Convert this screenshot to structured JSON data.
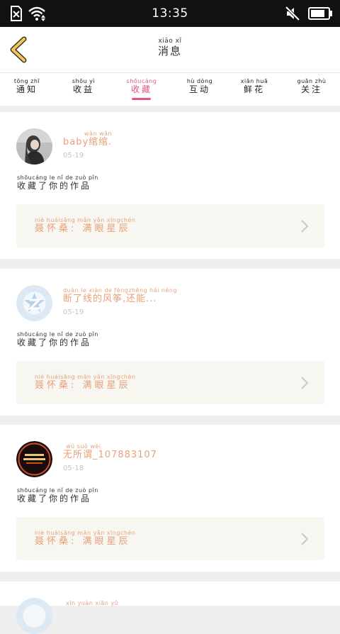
{
  "status_bar": {
    "time": "13:35"
  },
  "header": {
    "title_pinyin": "xiāo  xī",
    "title": "消息"
  },
  "tabs": [
    {
      "pinyin": "tōng zhī",
      "label": "通知"
    },
    {
      "pinyin": "shōu yì",
      "label": "收益"
    },
    {
      "pinyin": "shōucáng",
      "label": "收藏"
    },
    {
      "pinyin": "hù dòng",
      "label": "互动"
    },
    {
      "pinyin": "xiān huā",
      "label": "鲜花"
    },
    {
      "pinyin": "guān zhù",
      "label": "关注"
    }
  ],
  "active_tab_index": 2,
  "colors": {
    "accent": "#e2577f",
    "name": "#e9a07a",
    "work_bg": "#f7f6f0"
  },
  "cards": [
    {
      "avatar": "photo-avatar",
      "name_pinyin": "wǎn wǎn",
      "name": "baby绾绾.",
      "date": "05-19",
      "action_pinyin": "shōucáng le  nǐ  de zuò pǐn",
      "action": "收藏了你的作品",
      "work_pinyin": "niè huáisāng   mǎn yǎn xīngchén",
      "work": "聂怀桑: 满眼星辰"
    },
    {
      "avatar": "default-avatar",
      "name_pinyin": "duàn le xiàn de fēngzhēng hái néng",
      "name": "断了线的风筝,还能...",
      "date": "05-19",
      "action_pinyin": "shōucáng le  nǐ  de zuò pǐn",
      "action": "收藏了你的作品",
      "work_pinyin": "niè huáisāng   mǎn yǎn xīngchén",
      "work": "聂怀桑: 满眼星辰"
    },
    {
      "avatar": "badge-avatar",
      "name_pinyin": "wú suǒ wèi",
      "name": "无所谓_107883107",
      "date": "05-18",
      "action_pinyin": "shōucáng le  nǐ  de zuò pǐn",
      "action": "收藏了你的作品",
      "work_pinyin": "niè huáisāng   mǎn yǎn xīngchén",
      "work": "聂怀桑: 满眼星辰"
    },
    {
      "avatar": "default-avatar",
      "name_pinyin": "xīn yuàn xiān yǔ",
      "name": "",
      "date": "",
      "action_pinyin": "",
      "action": "",
      "work_pinyin": "",
      "work": ""
    }
  ]
}
